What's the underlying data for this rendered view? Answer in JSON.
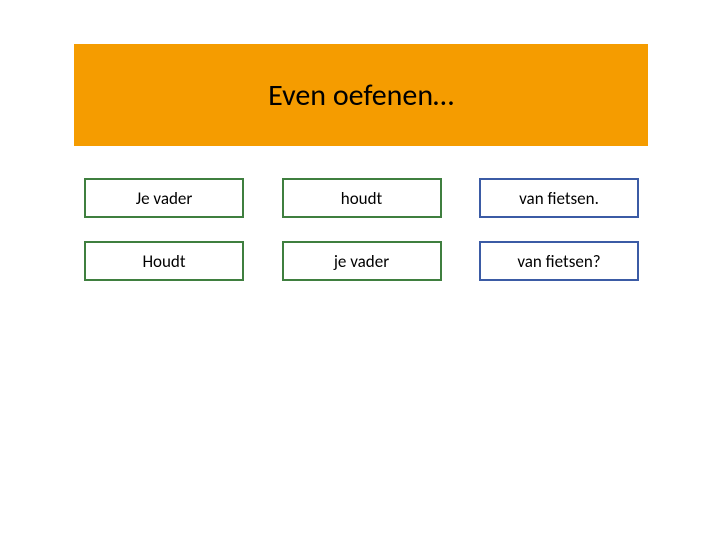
{
  "header": {
    "title": "Even oefenen…"
  },
  "rows": [
    {
      "c1": "Je vader",
      "c2": "houdt",
      "c3": "van fietsen."
    },
    {
      "c1": "Houdt",
      "c2": "je vader",
      "c3": "van fietsen?"
    }
  ]
}
